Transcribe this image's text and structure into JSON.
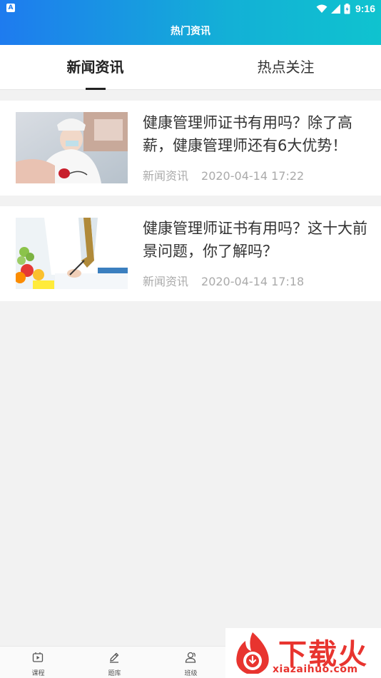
{
  "status_bar": {
    "time": "9:16",
    "app_icon_letter": "A",
    "icons": [
      "wifi-icon",
      "signal-icon",
      "battery-icon"
    ]
  },
  "header": {
    "title": "热门资讯"
  },
  "tabs": [
    {
      "label": "新闻资讯",
      "active": true
    },
    {
      "label": "热点关注",
      "active": false
    }
  ],
  "articles": [
    {
      "title": "健康管理师证书有用吗？除了高薪，健康管理师还有6大优势！",
      "category": "新闻资讯",
      "datetime": "2020-04-14 17:22",
      "image": "nurse-with-patient-photo"
    },
    {
      "title": "健康管理师证书有用吗？这十大前景问题，你了解吗？",
      "category": "新闻资讯",
      "datetime": "2020-04-14 17:18",
      "image": "doctor-writing-with-fruit-photo"
    }
  ],
  "bottom_nav": [
    {
      "label": "课程",
      "icon": "play-icon"
    },
    {
      "label": "题库",
      "icon": "pencil-icon"
    },
    {
      "label": "班级",
      "icon": "group-icon"
    }
  ],
  "watermark": {
    "brand": "下载火",
    "url": "xiazaihuo.com"
  },
  "colors": {
    "header_start": "#1e7bef",
    "header_end": "#0fc3cf",
    "watermark": "#e8342f"
  }
}
